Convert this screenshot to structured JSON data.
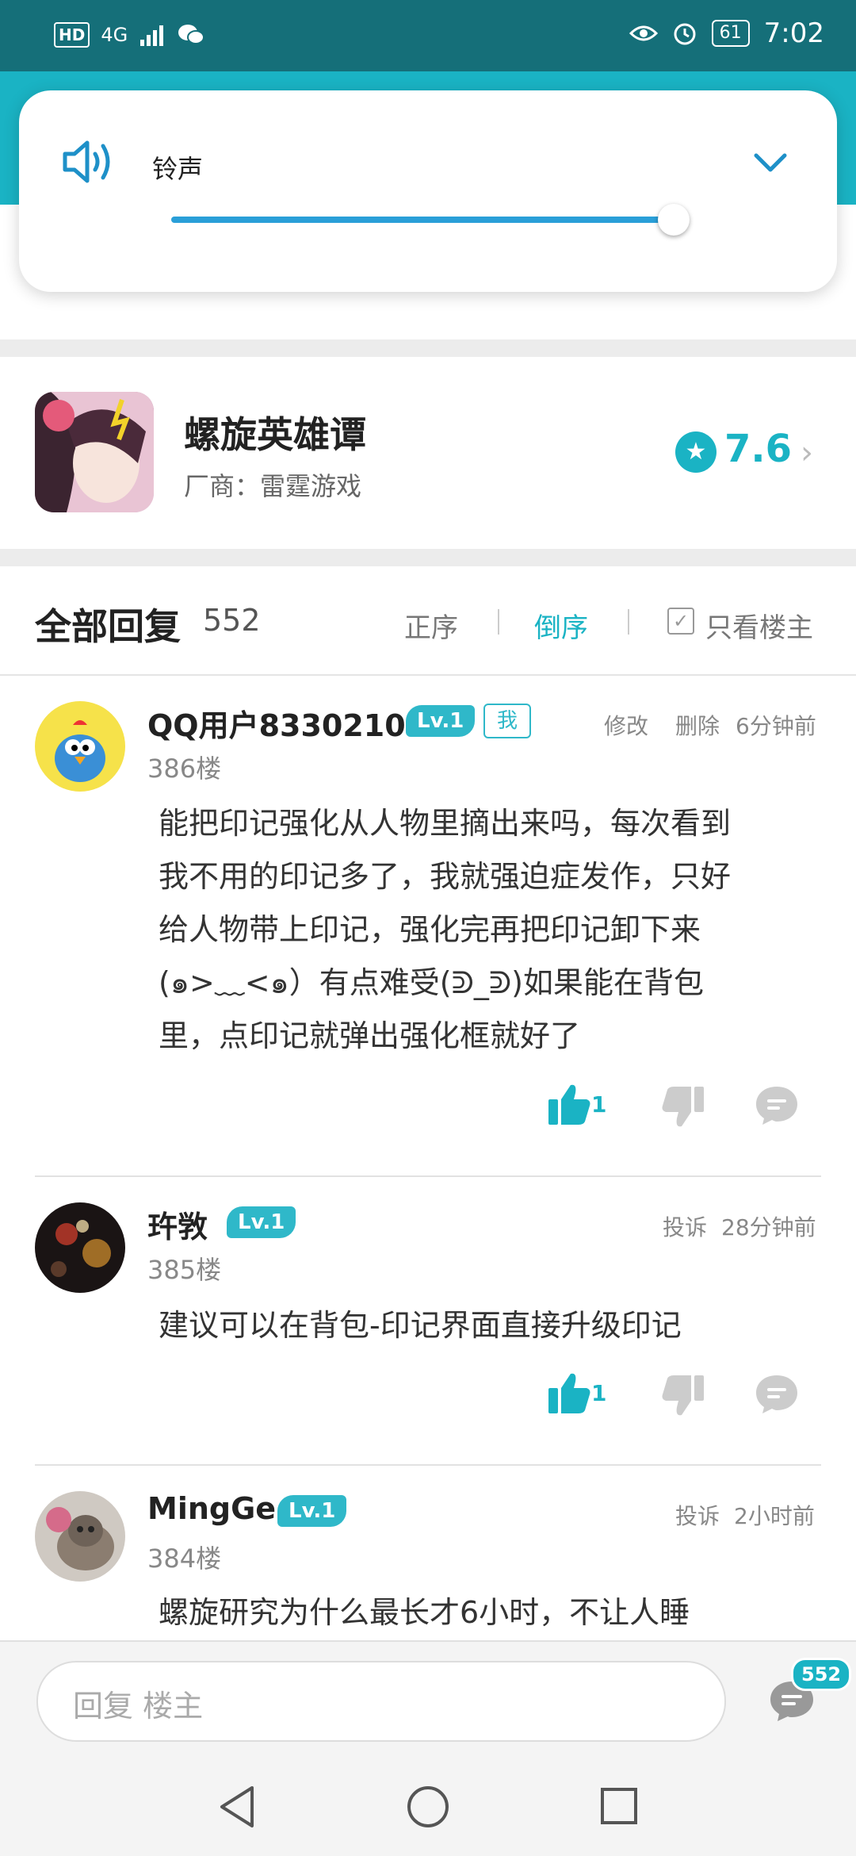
{
  "status_bar": {
    "left_indicators": [
      "HD",
      "4G"
    ],
    "battery": "61",
    "time": "7:02"
  },
  "volume": {
    "label": "铃声",
    "level_fraction": 0.95
  },
  "game": {
    "name": "螺旋英雄谭",
    "maker": "厂商：雷霆游戏",
    "rating": "7.6"
  },
  "replies": {
    "title": "全部回复",
    "count": "552",
    "sort_asc": "正序",
    "sort_desc": "倒序",
    "only_op": "只看楼主"
  },
  "comments": [
    {
      "username": "QQ用户8330210",
      "level": "Lv.1",
      "me_badge": "我",
      "actions": [
        "修改",
        "删除"
      ],
      "time": "6分钟前",
      "floor": "386楼",
      "text_lines": [
        "能把印记强化从人物里摘出来吗，每次看到",
        "我不用的印记多了，我就强迫症发作，只好",
        "给人物带上印记，强化完再把印记卸下来",
        "(๑>﹏<๑）有点难受(ᕲ_ᕲ)如果能在背包",
        "里，点印记就弹出强化框就好了"
      ],
      "likes": "1"
    },
    {
      "username": "玝敩",
      "level": "Lv.1",
      "actions": [
        "投诉"
      ],
      "time": "28分钟前",
      "floor": "385楼",
      "text_lines": [
        "建议可以在背包-印记界面直接升级印记"
      ],
      "likes": "1"
    },
    {
      "username": "MingGe",
      "level": "Lv.1",
      "actions": [
        "投诉"
      ],
      "time": "2小时前",
      "floor": "384楼",
      "text_lines": [
        "螺旋研究为什么最长才6小时，不让人睡"
      ]
    }
  ],
  "reply_bar": {
    "placeholder": "回复  楼主",
    "badge_count": "552"
  },
  "colors": {
    "teal": "#1ab3c4",
    "status_bar": "#156f79",
    "slider": "#2a9fd8"
  }
}
